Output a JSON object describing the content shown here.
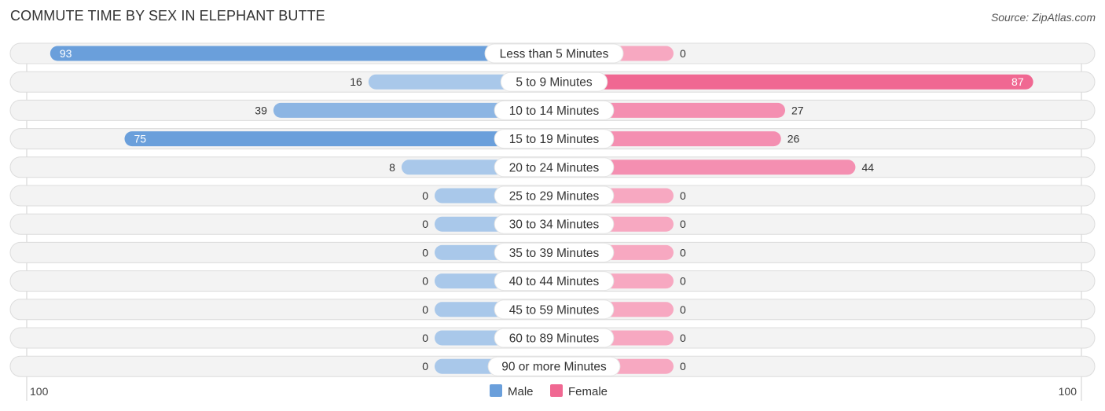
{
  "chart_data": {
    "type": "bar",
    "orientation": "horizontal-diverging",
    "title": "COMMUTE TIME BY SEX IN ELEPHANT BUTTE",
    "source": "Source: ZipAtlas.com",
    "categories": [
      "Less than 5 Minutes",
      "5 to 9 Minutes",
      "10 to 14 Minutes",
      "15 to 19 Minutes",
      "20 to 24 Minutes",
      "25 to 29 Minutes",
      "30 to 34 Minutes",
      "35 to 39 Minutes",
      "40 to 44 Minutes",
      "45 to 59 Minutes",
      "60 to 89 Minutes",
      "90 or more Minutes"
    ],
    "series": [
      {
        "name": "Male",
        "color": "#6a9fdb",
        "light_color": "#a9c8ea",
        "values": [
          93,
          16,
          39,
          75,
          8,
          0,
          0,
          0,
          0,
          0,
          0,
          0
        ]
      },
      {
        "name": "Female",
        "color": "#f06892",
        "light_color": "#f7a8c1",
        "values": [
          0,
          87,
          27,
          26,
          44,
          0,
          0,
          0,
          0,
          0,
          0,
          0
        ]
      }
    ],
    "axis": {
      "left_tick": "100",
      "right_tick": "100",
      "max": 100
    },
    "legend": {
      "position": "bottom-center",
      "items": [
        "Male",
        "Female"
      ]
    }
  }
}
